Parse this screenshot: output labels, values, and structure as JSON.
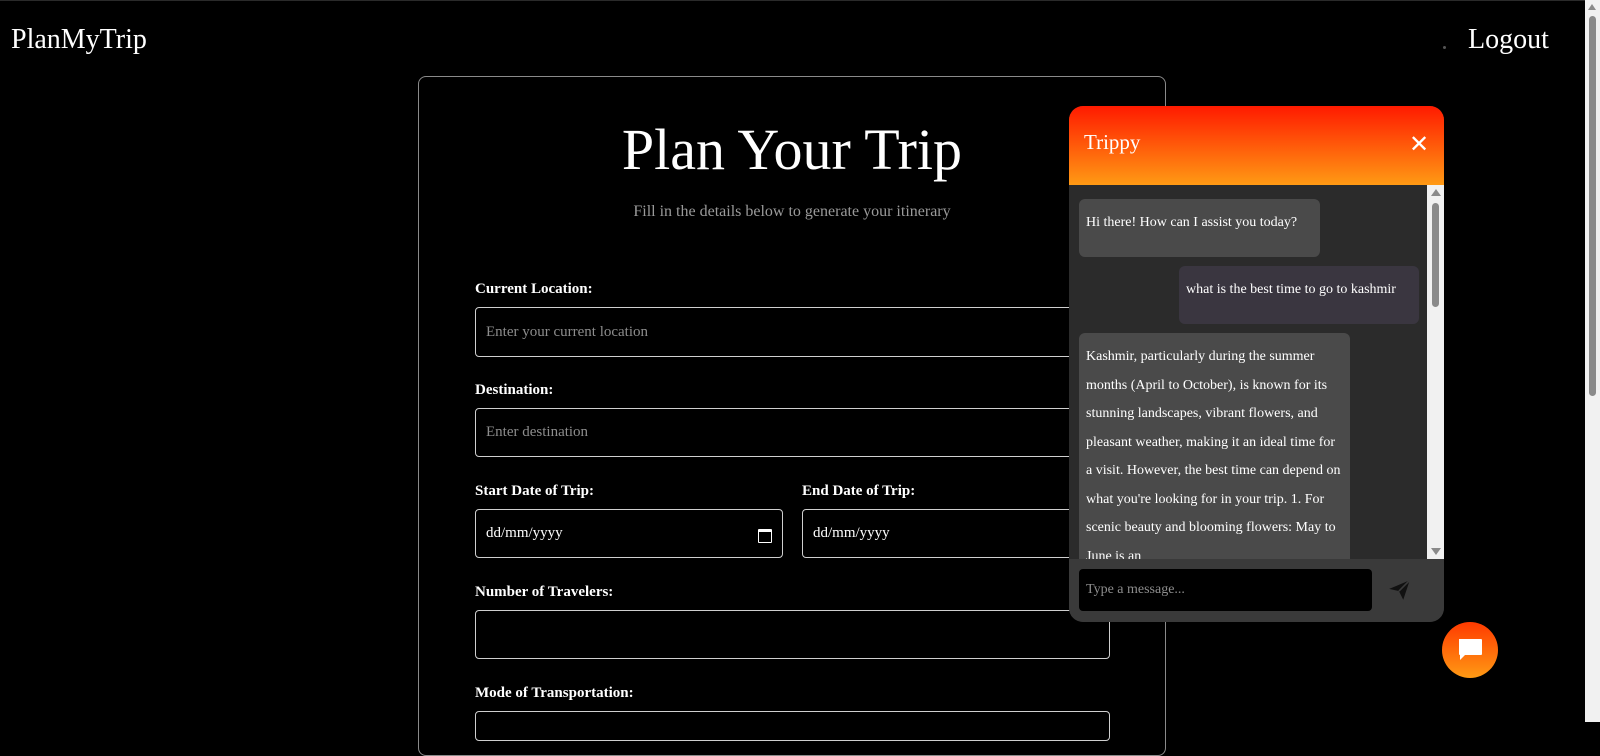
{
  "header": {
    "brand": "PlanMyTrip",
    "logout_label": "Logout"
  },
  "form": {
    "title": "Plan Your Trip",
    "subtitle": "Fill in the details below to generate your itinerary",
    "current_location": {
      "label": "Current Location:",
      "placeholder": "Enter your current location",
      "value": ""
    },
    "destination": {
      "label": "Destination:",
      "placeholder": "Enter destination",
      "value": ""
    },
    "start_date": {
      "label": "Start Date of Trip:",
      "value": "dd/mm/yyyy"
    },
    "end_date": {
      "label": "End Date of Trip:",
      "value": "dd/mm/yyyy"
    },
    "travelers": {
      "label": "Number of Travelers:",
      "value": ""
    },
    "transport": {
      "label": "Mode of Transportation:"
    }
  },
  "chat": {
    "title": "Trippy",
    "close_icon": "close-icon",
    "messages": [
      {
        "role": "bot",
        "text": "Hi there! How can I assist you today?"
      },
      {
        "role": "user",
        "text": "what is the best time to go to kashmir"
      },
      {
        "role": "bot",
        "text": "Kashmir, particularly during the summer months (April to October), is known for its stunning landscapes, vibrant flowers, and pleasant weather, making it an ideal time for a visit. However, the best time can depend on what you're looking for in your trip. 1. For scenic beauty and blooming flowers: May to June is an"
      }
    ],
    "input_placeholder": "Type a message...",
    "send_icon": "send-icon",
    "toggle_icon": "chat-bubble-icon"
  },
  "colors": {
    "background": "#000000",
    "accent_top": "#ff1a00",
    "accent_bottom": "#ff9a14",
    "chat_panel": "#2b2b2b",
    "bot_bubble": "#4a4a4a",
    "user_bubble": "#3a3640"
  }
}
